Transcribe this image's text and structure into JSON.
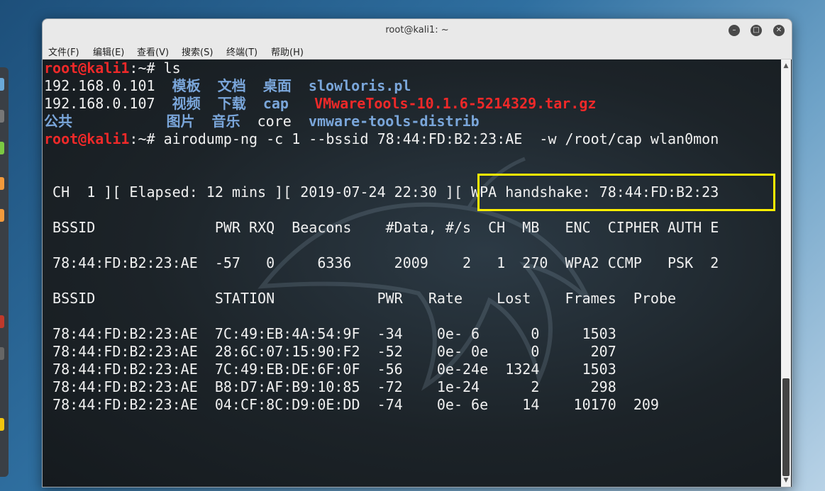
{
  "window": {
    "title": "root@kali1: ~",
    "menu": [
      "文件(F)",
      "编辑(E)",
      "查看(V)",
      "搜索(S)",
      "终端(T)",
      "帮助(H)"
    ],
    "controls": {
      "minimize_icon": "minimize-icon",
      "maximize_icon": "maximize-icon",
      "close_icon": "close-icon"
    }
  },
  "colors": {
    "prompt": "#ef2929",
    "dir": "#7aa6da",
    "highlight": "#ffef00"
  },
  "terminal": {
    "prompt_user": "root@kali1",
    "prompt_rest": ":~# ",
    "cmd1": "ls",
    "ls_rows": [
      [
        "192.168.0.101",
        "模板",
        "文档",
        "桌面",
        "slowloris.pl"
      ],
      [
        "192.168.0.107",
        "视频",
        "下载",
        "cap",
        "VMwareTools-10.1.6-5214329.tar.gz"
      ],
      [
        "公共",
        "图片",
        "音乐",
        "core",
        "vmware-tools-distrib"
      ]
    ],
    "cmd2": "airodump-ng -c 1 --bssid 78:44:FD:B2:23:AE  -w /root/cap wlan0mon",
    "status_left": " CH  1 ][ Elapsed: 12 mins ][ 2019-07-24 22:30 ]",
    "status_right": "[ WPA handshake: 78:44:FD:B2:23",
    "ap_header": " BSSID              PWR RXQ  Beacons    #Data, #/s  CH  MB   ENC  CIPHER AUTH E",
    "ap_row": " 78:44:FD:B2:23:AE  -57   0     6336     2009    2   1  270  WPA2 CCMP   PSK  2",
    "st_header": " BSSID              STATION            PWR   Rate    Lost    Frames  Probe",
    "st_rows": [
      " 78:44:FD:B2:23:AE  7C:49:EB:4A:54:9F  -34    0e- 6      0     1503",
      " 78:44:FD:B2:23:AE  28:6C:07:15:90:F2  -52    0e- 0e     0      207",
      " 78:44:FD:B2:23:AE  7C:49:EB:DE:6F:0F  -56    0e-24e  1324     1503",
      " 78:44:FD:B2:23:AE  B8:D7:AF:B9:10:85  -72    1e-24      2      298",
      " 78:44:FD:B2:23:AE  04:CF:8C:D9:0E:DD  -74    0e- 6e    14    10170  209"
    ]
  }
}
